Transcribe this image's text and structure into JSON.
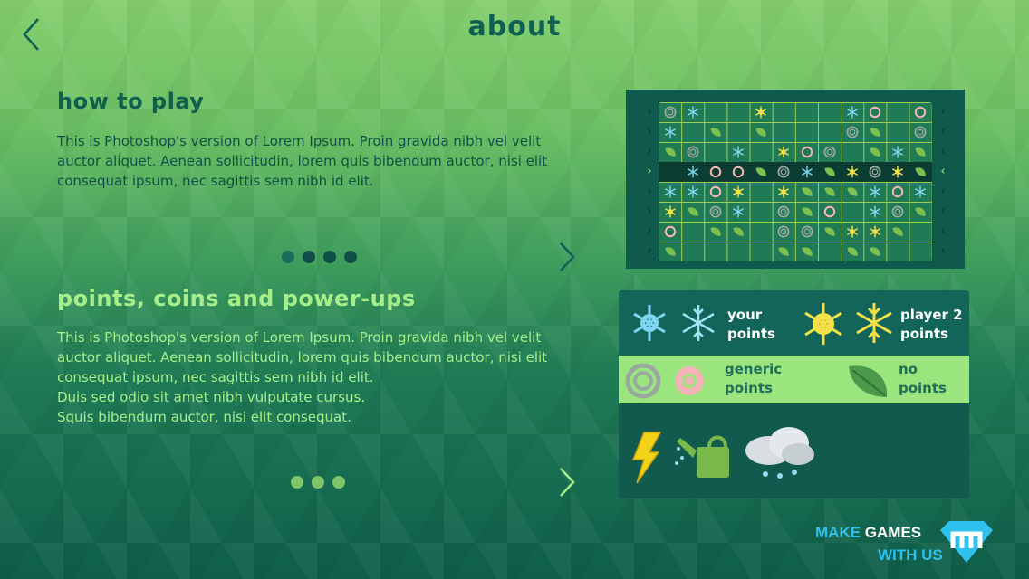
{
  "header": {
    "title": "about"
  },
  "sections": [
    {
      "heading": "how to play",
      "body": "This is Photoshop's version  of Lorem Ipsum. Proin gravida nibh vel velit auctor aliquet. Aenean sollicitudin, lorem quis bibendum auctor, nisi elit consequat ipsum, nec sagittis sem nibh id elit."
    },
    {
      "heading": "points, coins and power-ups",
      "body_lines": [
        "This is Photoshop's version  of Lorem Ipsum. Proin gravida nibh vel velit auctor aliquet. Aenean sollicitudin, lorem quis bibendum auctor, nisi elit consequat ipsum, nec sagittis sem nibh id elit.",
        "Duis sed odio sit amet nibh vulputate cursus.",
        "Squis bibendum auctor, nisi elit consequat."
      ]
    }
  ],
  "pager1": {
    "count": 4,
    "active": 0
  },
  "pager2": {
    "count": 3,
    "active": 0
  },
  "legend": {
    "your_points": "your\npoints",
    "player2_points": "player 2\npoints",
    "generic_points": "generic\npoints",
    "no_points": "no\npoints",
    "power_ups": "power-ups"
  },
  "brand": {
    "make": "MAKE",
    "games": "GAMES",
    "with_us": "WITH US"
  },
  "board": {
    "cols": 12,
    "rows": 8,
    "highlight_row": 3,
    "pieces": [
      [
        0,
        0,
        "ring"
      ],
      [
        1,
        0,
        "flakeB"
      ],
      [
        4,
        0,
        "flakeY"
      ],
      [
        8,
        0,
        "flakeB"
      ],
      [
        9,
        0,
        "ringP"
      ],
      [
        11,
        0,
        "ringP"
      ],
      [
        0,
        1,
        "flakeB"
      ],
      [
        2,
        1,
        "leaf"
      ],
      [
        4,
        1,
        "leaf"
      ],
      [
        8,
        1,
        "ring"
      ],
      [
        9,
        1,
        "leaf"
      ],
      [
        11,
        1,
        "ring"
      ],
      [
        0,
        2,
        "leaf"
      ],
      [
        1,
        2,
        "ring"
      ],
      [
        3,
        2,
        "flakeB"
      ],
      [
        5,
        2,
        "flakeY"
      ],
      [
        6,
        2,
        "ringP"
      ],
      [
        7,
        2,
        "ring"
      ],
      [
        9,
        2,
        "leaf"
      ],
      [
        10,
        2,
        "flakeB"
      ],
      [
        11,
        2,
        "leaf"
      ],
      [
        1,
        3,
        "flakeB"
      ],
      [
        2,
        3,
        "ringP"
      ],
      [
        3,
        3,
        "ringP"
      ],
      [
        4,
        3,
        "leaf"
      ],
      [
        5,
        3,
        "ring"
      ],
      [
        6,
        3,
        "flakeB"
      ],
      [
        7,
        3,
        "leaf"
      ],
      [
        8,
        3,
        "flakeY"
      ],
      [
        9,
        3,
        "ring"
      ],
      [
        10,
        3,
        "flakeY"
      ],
      [
        11,
        3,
        "leaf"
      ],
      [
        0,
        4,
        "flakeB"
      ],
      [
        1,
        4,
        "flakeB"
      ],
      [
        2,
        4,
        "ringP"
      ],
      [
        3,
        4,
        "flakeY"
      ],
      [
        5,
        4,
        "flakeY"
      ],
      [
        6,
        4,
        "leaf"
      ],
      [
        7,
        4,
        "leaf"
      ],
      [
        8,
        4,
        "leaf"
      ],
      [
        9,
        4,
        "flakeB"
      ],
      [
        10,
        4,
        "ringP"
      ],
      [
        11,
        4,
        "flakeB"
      ],
      [
        0,
        5,
        "flakeY"
      ],
      [
        1,
        5,
        "leaf"
      ],
      [
        2,
        5,
        "ring"
      ],
      [
        3,
        5,
        "flakeB"
      ],
      [
        5,
        5,
        "ring"
      ],
      [
        6,
        5,
        "leaf"
      ],
      [
        7,
        5,
        "ringP"
      ],
      [
        9,
        5,
        "flakeB"
      ],
      [
        10,
        5,
        "ring"
      ],
      [
        11,
        5,
        "leaf"
      ],
      [
        0,
        6,
        "ringP"
      ],
      [
        2,
        6,
        "leaf"
      ],
      [
        3,
        6,
        "leaf"
      ],
      [
        5,
        6,
        "ring"
      ],
      [
        6,
        6,
        "ring"
      ],
      [
        7,
        6,
        "leaf"
      ],
      [
        8,
        6,
        "flakeY"
      ],
      [
        9,
        6,
        "flakeY"
      ],
      [
        10,
        6,
        "leaf"
      ],
      [
        0,
        7,
        "leaf"
      ],
      [
        5,
        7,
        "leaf"
      ],
      [
        6,
        7,
        "leaf"
      ],
      [
        8,
        7,
        "leaf"
      ],
      [
        9,
        7,
        "leaf"
      ]
    ]
  },
  "colors": {
    "title": "#0f5f55",
    "heading_dark": "#11604f",
    "heading_light": "#a6ee8a",
    "board_bg": "#1f7a55",
    "grid": "#9bcf53",
    "brand_blue": "#2ec0ef"
  }
}
